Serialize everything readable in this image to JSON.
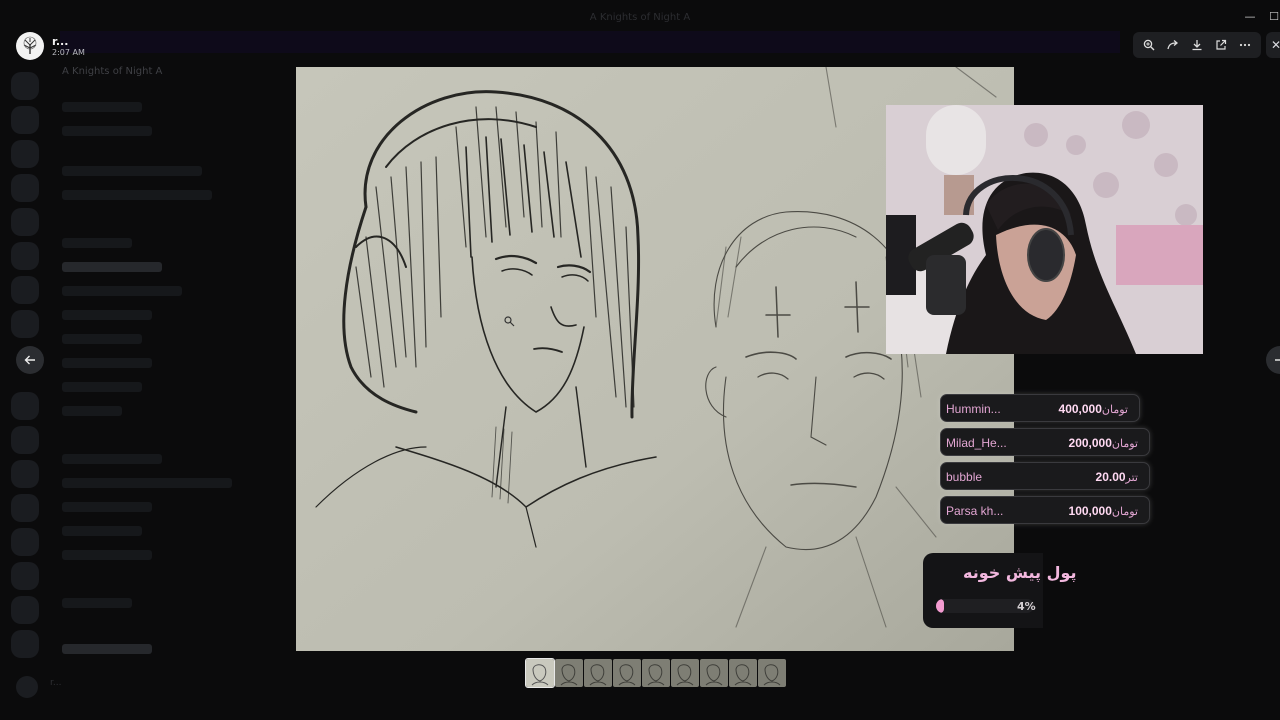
{
  "window": {
    "title": "A Knights of Night A"
  },
  "server": {
    "name": "A Knights of Night A"
  },
  "banner": {
    "text": ""
  },
  "author": {
    "name": "r...",
    "time": "2:07 AM"
  },
  "toolbar": {
    "buttons": [
      "zoom-in-icon",
      "forward-icon",
      "download-icon",
      "open-external-icon",
      "more-icon"
    ]
  },
  "overlay": {
    "donations": [
      {
        "name": "Hummin...",
        "amount": "400,000",
        "currency": "تومان"
      },
      {
        "name": "Milad_He...",
        "amount": "200,000",
        "currency": "تومان"
      },
      {
        "name": "bubble",
        "amount": "20.00",
        "currency": "تتر"
      },
      {
        "name": "Parsa kh...",
        "amount": "100,000",
        "currency": "تومان"
      }
    ],
    "goal": {
      "title": "پول پیش خونه",
      "percent_label": "4%",
      "percent": 4
    }
  },
  "gallery": {
    "thumbnail_count": 9,
    "selected_index": 0
  },
  "colors": {
    "accent_pink": "#f39bd0",
    "donation_text": "#e3a6d3",
    "toolbar_bg": "#1e1f22"
  }
}
